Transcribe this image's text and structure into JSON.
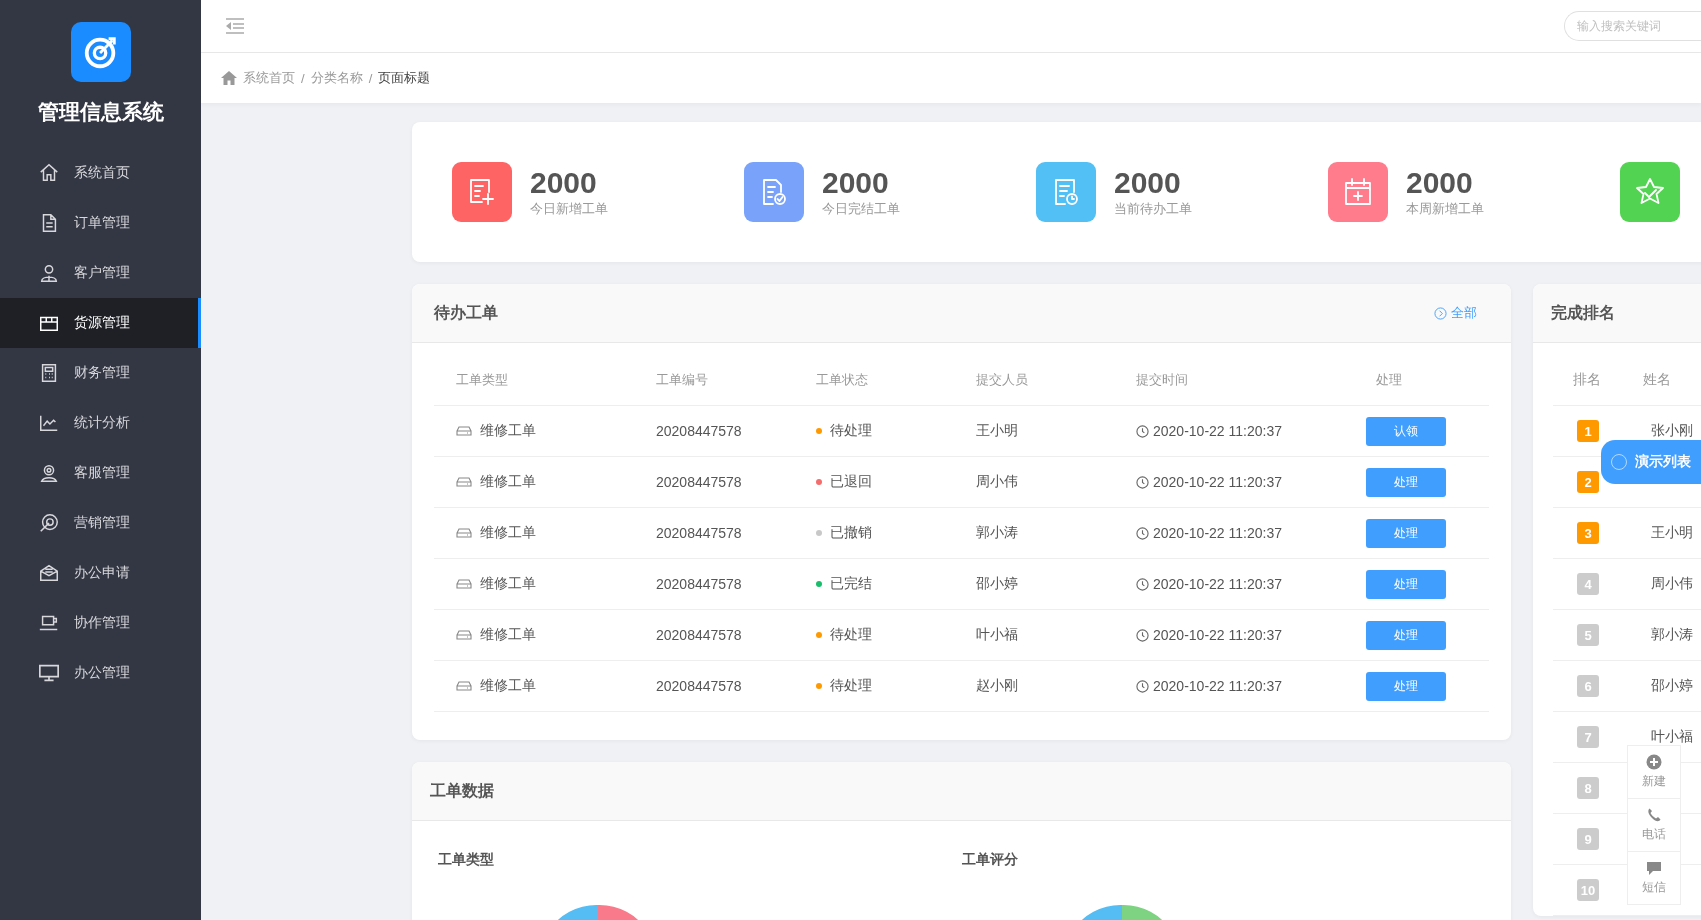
{
  "sidebar": {
    "title": "管理信息系统",
    "items": [
      {
        "label": "系统首页",
        "selected": false
      },
      {
        "label": "订单管理",
        "selected": false
      },
      {
        "label": "客户管理",
        "selected": false
      },
      {
        "label": "货源管理",
        "selected": true
      },
      {
        "label": "财务管理",
        "selected": false
      },
      {
        "label": "统计分析",
        "selected": false
      },
      {
        "label": "客服管理",
        "selected": false
      },
      {
        "label": "营销管理",
        "selected": false
      },
      {
        "label": "办公申请",
        "selected": false
      },
      {
        "label": "协作管理",
        "selected": false
      },
      {
        "label": "办公管理",
        "selected": false
      }
    ]
  },
  "header": {
    "search": {
      "placeholder": "输入搜索关键词"
    }
  },
  "breadcrumb": {
    "separator": "/",
    "items": [
      "系统首页",
      "分类名称",
      "页面标题"
    ]
  },
  "stats": [
    {
      "value": "2000",
      "label": "今日新增工单",
      "color": "#ff6464"
    },
    {
      "value": "2000",
      "label": "今日完结工单",
      "color": "#79a2fa"
    },
    {
      "value": "2000",
      "label": "当前待办工单",
      "color": "#52bff5"
    },
    {
      "value": "2000",
      "label": "本周新增工单",
      "color": "#ff7c8c"
    },
    {
      "color": "#52d452"
    }
  ],
  "pending": {
    "title": "待办工单",
    "link": "全部",
    "columns": [
      "工单类型",
      "工单编号",
      "工单状态",
      "提交人员",
      "提交时间",
      "处理"
    ],
    "rows": [
      {
        "type": "维修工单",
        "number": "20208447578",
        "status": "待处理",
        "color": "#ff9900",
        "person": "王小明",
        "time": "2020-10-22 11:20:37",
        "action": "认领"
      },
      {
        "type": "维修工单",
        "number": "20208447578",
        "status": "已退回",
        "color": "#f56c6c",
        "person": "周小伟",
        "time": "2020-10-22 11:20:37",
        "action": "处理"
      },
      {
        "type": "维修工单",
        "number": "20208447578",
        "status": "已撤销",
        "color": "#c8c8c8",
        "person": "郭小涛",
        "time": "2020-10-22 11:20:37",
        "action": "处理"
      },
      {
        "type": "维修工单",
        "number": "20208447578",
        "status": "已完结",
        "color": "#19be6b",
        "person": "邵小婷",
        "time": "2020-10-22 11:20:37",
        "action": "处理"
      },
      {
        "type": "维修工单",
        "number": "20208447578",
        "status": "待处理",
        "color": "#ff9900",
        "person": "叶小福",
        "time": "2020-10-22 11:20:37",
        "action": "处理"
      },
      {
        "type": "维修工单",
        "number": "20208447578",
        "status": "待处理",
        "color": "#ff9900",
        "person": "赵小刚",
        "time": "2020-10-22 11:20:37",
        "action": "处理"
      }
    ]
  },
  "data_panel": {
    "title": "工单数据",
    "sections": [
      {
        "title": "工单类型"
      },
      {
        "title": "工单评分"
      }
    ]
  },
  "ranking": {
    "title": "完成排名",
    "columns": [
      "排名",
      "姓名"
    ],
    "rows": [
      {
        "rank": "1",
        "color": "#ff9900",
        "name": "张小刚"
      },
      {
        "rank": "2",
        "color": "#ff9900"
      },
      {
        "rank": "3",
        "color": "#ff9900",
        "name": "王小明"
      },
      {
        "rank": "4",
        "color": "#cccccc",
        "name": "周小伟"
      },
      {
        "rank": "5",
        "color": "#cccccc",
        "name": "郭小涛"
      },
      {
        "rank": "6",
        "color": "#cccccc",
        "name": "邵小婷"
      },
      {
        "rank": "7",
        "color": "#cccccc",
        "name": "叶小福"
      },
      {
        "rank": "8",
        "color": "#cccccc"
      },
      {
        "rank": "9",
        "color": "#cccccc"
      },
      {
        "rank": "10",
        "color": "#cccccc"
      }
    ]
  },
  "demo_button": "演示列表",
  "quick_actions": [
    "新建",
    "电话",
    "短信"
  ]
}
